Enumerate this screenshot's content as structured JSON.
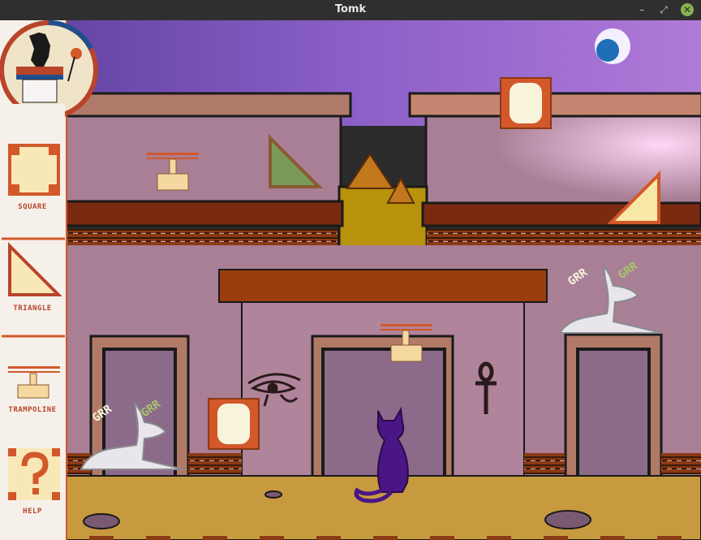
{
  "window": {
    "title": "Tomk",
    "minimize_glyph": "–",
    "restore_glyph": "⤢",
    "close_glyph": "✕"
  },
  "sidebar": {
    "tools": [
      {
        "id": "square",
        "label": "SQUARE",
        "icon": "square-block-icon"
      },
      {
        "id": "triangle",
        "label": "TRIANGLE",
        "icon": "triangle-ramp-icon"
      },
      {
        "id": "trampoline",
        "label": "TRAMPOLINE",
        "icon": "trampoline-icon"
      },
      {
        "id": "help",
        "label": "HELP",
        "icon": "question-block-icon"
      }
    ]
  },
  "scene": {
    "guards": [
      {
        "text_1": "GRR",
        "text_2": "GRR"
      },
      {
        "text_1": "GRR",
        "text_2": "GRR"
      }
    ]
  },
  "colors": {
    "sky_top": "#6a4fb0",
    "sky_glow": "#f0a8e0",
    "wall": "#a87f96",
    "roof_brown": "#8a3a14",
    "ground": "#c79a3f",
    "accent_orange": "#d2582a",
    "cat_purple": "#4a1585",
    "guard_white": "#e8e6ea"
  }
}
